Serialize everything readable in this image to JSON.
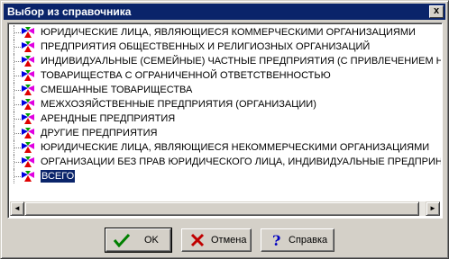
{
  "window": {
    "title": "Выбор из справочника",
    "close_label": "x"
  },
  "list": {
    "items": [
      {
        "label": "ЮРИДИЧЕСКИЕ ЛИЦА, ЯВЛЯЮЩИЕСЯ КОММЕРЧЕСКИМИ ОРГАНИЗАЦИЯМИ",
        "selected": false
      },
      {
        "label": "ПРЕДПРИЯТИЯ ОБЩЕСТВЕННЫХ И РЕЛИГИОЗНЫХ ОРГАНИЗАЦИЙ",
        "selected": false
      },
      {
        "label": "ИНДИВИДУАЛЬНЫЕ (СЕМЕЙНЫЕ) ЧАСТНЫЕ ПРЕДПРИЯТИЯ (С ПРИВЛЕЧЕНИЕМ Н",
        "selected": false
      },
      {
        "label": "ТОВАРИЩЕСТВА С ОГРАНИЧЕННОЙ ОТВЕТСТВЕННОСТЬЮ",
        "selected": false
      },
      {
        "label": "СМЕШАННЫЕ ТОВАРИЩЕСТВА",
        "selected": false
      },
      {
        "label": "МЕЖХОЗЯЙСТВЕННЫЕ ПРЕДПРИЯТИЯ (ОРГАНИЗАЦИИ)",
        "selected": false
      },
      {
        "label": "АРЕНДНЫЕ ПРЕДПРИЯТИЯ",
        "selected": false
      },
      {
        "label": "ДРУГИЕ ПРЕДПРИЯТИЯ",
        "selected": false
      },
      {
        "label": "ЮРИДИЧЕСКИЕ ЛИЦА, ЯВЛЯЮЩИЕСЯ НЕКОММЕРЧЕСКИМИ ОРГАНИЗАЦИЯМИ",
        "selected": false
      },
      {
        "label": "ОРГАНИЗАЦИИ БЕЗ ПРАВ ЮРИДИЧЕСКОГО ЛИЦА, ИНДИВИДУАЛЬНЫЕ ПРЕДПРИН",
        "selected": false
      },
      {
        "label": "ВСЕГО",
        "selected": true
      }
    ]
  },
  "scrollbar": {
    "left_arrow": "◄",
    "right_arrow": "►"
  },
  "buttons": {
    "ok": "OK",
    "cancel": "Отмена",
    "help": "Справка"
  },
  "colors": {
    "titlebar": "#0a246a",
    "selection": "#0a246a",
    "face": "#d4d0c8"
  }
}
